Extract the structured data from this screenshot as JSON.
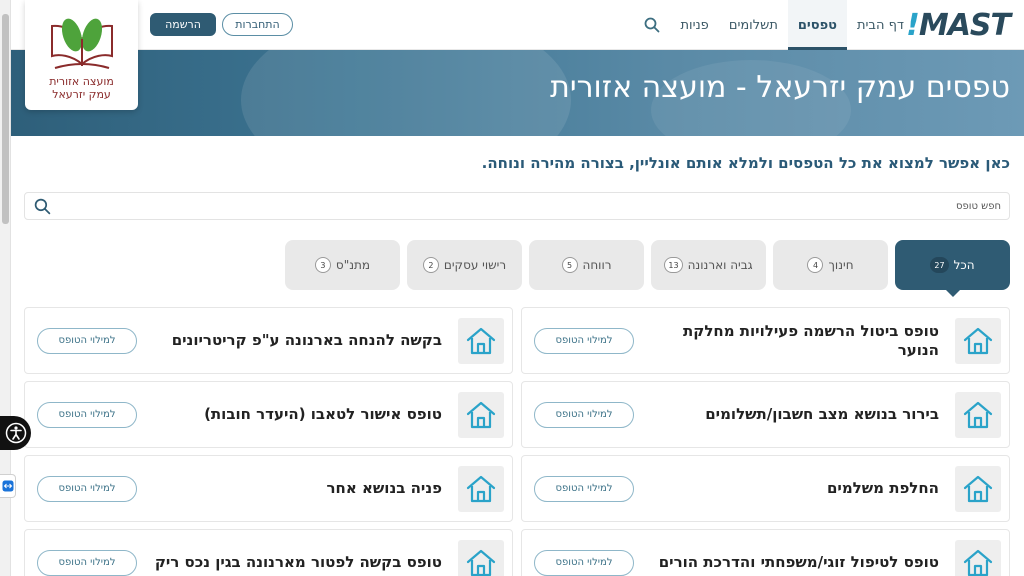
{
  "header": {
    "logo_text": "MAST",
    "logo_bang": "!",
    "nav": [
      {
        "label": "דף הבית",
        "active": false
      },
      {
        "label": "טפסים",
        "active": true
      },
      {
        "label": "תשלומים",
        "active": false
      },
      {
        "label": "פניות",
        "active": false
      }
    ],
    "register_label": "הרשמה",
    "login_label": "התחברות"
  },
  "council": {
    "line1": "מועצה אזורית",
    "line2": "עמק  יזרעאל"
  },
  "banner": {
    "title": "טפסים עמק יזרעאל - מועצה אזורית"
  },
  "subtitle": "כאן אפשר למצוא את כל הטפסים ולמלא אותם אונליין, בצורה מהירה ונוחה.",
  "search": {
    "placeholder": "חפש טופס",
    "value": ""
  },
  "tabs": [
    {
      "label": "הכל",
      "count": "27",
      "active": true
    },
    {
      "label": "חינוך",
      "count": "4",
      "active": false
    },
    {
      "label": "גביה וארנונה",
      "count": "13",
      "active": false
    },
    {
      "label": "רווחה",
      "count": "5",
      "active": false
    },
    {
      "label": "רישוי עסקים",
      "count": "2",
      "active": false
    },
    {
      "label": "מתנ\"ס",
      "count": "3",
      "active": false
    }
  ],
  "forms": [
    {
      "title": "טופס ביטול הרשמה פעילויות מחלקת הנוער",
      "button": "למילוי הטופס"
    },
    {
      "title": "בקשה להנחה בארנונה ע\"פ קריטריונים",
      "button": "למילוי הטופס"
    },
    {
      "title": "בירור בנושא מצב חשבון/תשלומים",
      "button": "למילוי הטופס"
    },
    {
      "title": "טופס אישור לטאבו (היעדר חובות)",
      "button": "למילוי הטופס"
    },
    {
      "title": "החלפת משלמים",
      "button": "למילוי הטופס"
    },
    {
      "title": "פניה בנושא אחר",
      "button": "למילוי הטופס"
    },
    {
      "title": "טופס לטיפול זוגי/משפחתי והדרכת הורים",
      "button": "למילוי הטופס"
    },
    {
      "title": "טופס בקשה לפטור מארנונה בגין נכס ריק",
      "button": "למילוי הטופס"
    }
  ],
  "colors": {
    "primary": "#2f5b73",
    "accent": "#2aa3c9",
    "council_red": "#8a2b2b"
  }
}
